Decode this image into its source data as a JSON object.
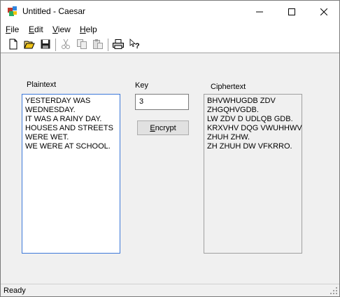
{
  "window": {
    "title": "Untitled - Caesar",
    "app_icon": "caesar-app-icon",
    "controls": [
      "minimize-icon",
      "maximize-icon",
      "close-icon"
    ]
  },
  "menu": {
    "file": {
      "accel": "F",
      "rest": "ile"
    },
    "edit": {
      "accel": "E",
      "rest": "dit"
    },
    "view": {
      "accel": "V",
      "rest": "iew"
    },
    "help": {
      "accel": "H",
      "rest": "elp"
    }
  },
  "toolbar": {
    "buttons": [
      {
        "icon": "new-document-icon",
        "enabled": true
      },
      {
        "icon": "open-folder-icon",
        "enabled": true
      },
      {
        "icon": "save-icon",
        "enabled": true
      },
      {
        "icon": "cut-icon",
        "enabled": false
      },
      {
        "icon": "copy-icon",
        "enabled": false
      },
      {
        "icon": "paste-icon",
        "enabled": false
      },
      {
        "icon": "print-icon",
        "enabled": true
      },
      {
        "icon": "help-icon",
        "enabled": true
      }
    ]
  },
  "main": {
    "plaintext_label": "Plaintext",
    "plaintext_value": "YESTERDAY WAS\nWEDNESDAY.\nIT WAS A RAINY DAY.\nHOUSES AND STREETS\nWERE WET.\nWE WERE AT SCHOOL.",
    "key_label": "Key",
    "key_value": "3",
    "encrypt": {
      "accel": "E",
      "rest": "ncrypt"
    },
    "ciphertext_label": "Ciphertext",
    "ciphertext_value": "BHVWHUGDB ZDV\nZHGQHVGDB.\nLW ZDV D UDLQB GDB.\nKRXVHV DQG VWUHHWV\nZHUH ZHW.\nZH ZHUH DW VFKRRO."
  },
  "status": {
    "text": "Ready"
  }
}
